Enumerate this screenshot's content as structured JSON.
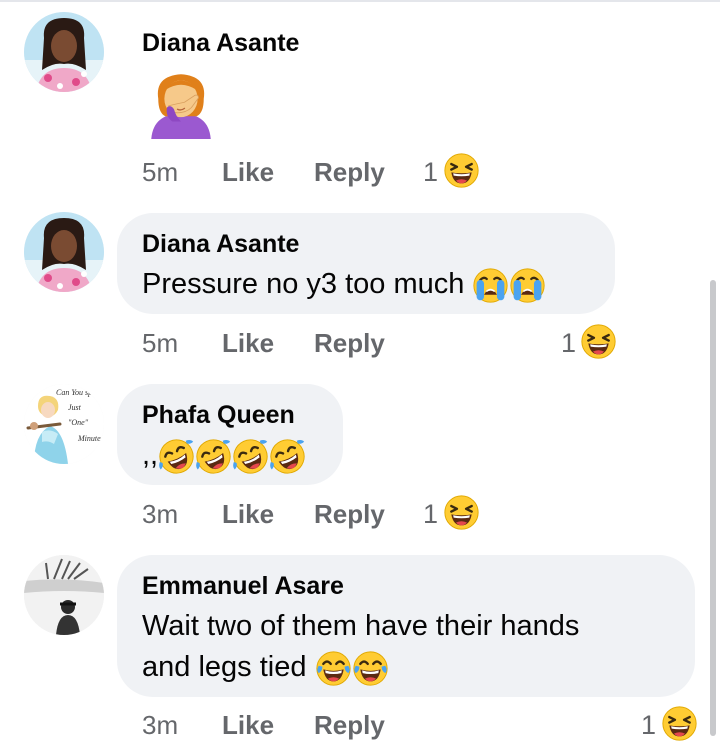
{
  "comments": [
    {
      "author": "Diana Asante",
      "body_emoji": "woman-facepalming-emoji",
      "time": "5m",
      "like": "Like",
      "reply": "Reply",
      "reaction_count": "1",
      "reaction_icon": "laughing-squint-emoji"
    },
    {
      "author": "Diana Asante",
      "text": "Pressure no y3 too much",
      "trailing_emojis": [
        "loudly-crying-emoji",
        "loudly-crying-emoji"
      ],
      "time": "5m",
      "like": "Like",
      "reply": "Reply",
      "reaction_count": "1",
      "reaction_icon": "laughing-squint-emoji"
    },
    {
      "author": "Phafa Queen",
      "text": ",,",
      "trailing_emojis": [
        "rolling-on-floor-laughing-emoji",
        "rolling-on-floor-laughing-emoji",
        "rolling-on-floor-laughing-emoji",
        "rolling-on-floor-laughing-emoji"
      ],
      "avatar_text": [
        "Can You sp",
        "Just",
        "\"One\"",
        "Minute"
      ],
      "time": "3m",
      "like": "Like",
      "reply": "Reply",
      "reaction_count": "1",
      "reaction_icon": "laughing-squint-emoji"
    },
    {
      "author": "Emmanuel Asare",
      "text_line1": "Wait two of them have their hands",
      "text_line2": "and legs tied",
      "trailing_emojis": [
        "tears-of-joy-emoji",
        "tears-of-joy-emoji"
      ],
      "time": "3m",
      "like": "Like",
      "reply": "Reply",
      "reaction_count": "1",
      "reaction_icon": "laughing-squint-emoji"
    }
  ],
  "colors": {
    "bubble": "#f0f2f5",
    "meta_text": "#65676b",
    "name_text": "#050505",
    "emoji_yellow": "#ffcc33"
  }
}
